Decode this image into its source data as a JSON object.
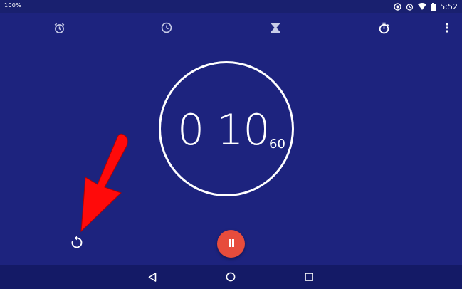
{
  "status_bar": {
    "left_indicator": "100%",
    "time": "5:52"
  },
  "toolbar": {
    "tabs": [
      {
        "name": "alarm",
        "icon": "alarm-icon"
      },
      {
        "name": "clock",
        "icon": "clock-icon"
      },
      {
        "name": "timer",
        "icon": "hourglass-icon"
      },
      {
        "name": "stopwatch",
        "icon": "stopwatch-icon"
      }
    ],
    "menu_icon": "overflow-menu-icon"
  },
  "timer": {
    "display_main": "0 10",
    "display_seconds": "60"
  },
  "controls": {
    "reset_icon": "reset-icon",
    "pause_icon": "pause-icon"
  },
  "navigation": {
    "back_icon": "back-icon",
    "home_icon": "home-icon",
    "recents_icon": "recents-icon"
  },
  "colors": {
    "background": "#1d237e",
    "pause_button": "#e74c3c",
    "annotation_arrow": "#ff0000"
  }
}
